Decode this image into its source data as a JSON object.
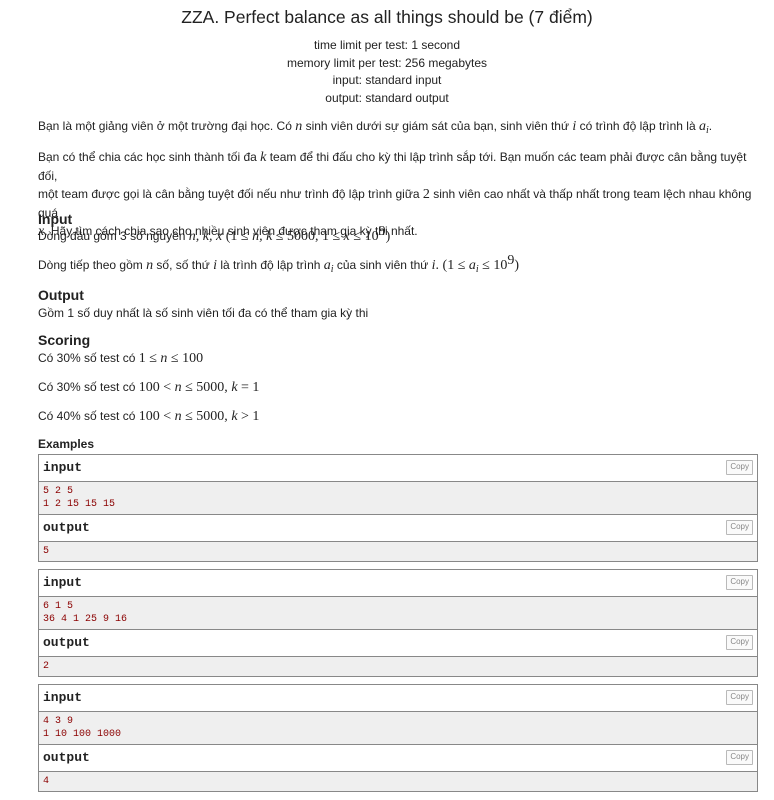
{
  "header": {
    "title": "ZZA. Perfect balance as all things should be (7 điểm)",
    "time_limit": "time limit per test: 1 second",
    "memory_limit": "memory limit per test: 256 megabytes",
    "input": "input: standard input",
    "output": "output: standard output"
  },
  "statement": {
    "p1_a": "Bạn là một giảng viên ở một trường đại học. Có ",
    "p1_n": "n",
    "p1_b": " sinh viên dưới sự giám sát của bạn, sinh viên thứ ",
    "p1_i": "i",
    "p1_c": " có trình độ lập trình là ",
    "p1_a_var": "a",
    "p1_a_sub": "i",
    "p1_end": ".",
    "p2_a": "Bạn có thể chia các học sinh thành tối đa ",
    "p2_k": "k",
    "p2_b": " team để thi đấu cho kỳ thi lập trình sắp tới. Bạn muốn các team phải được cân bằng tuyệt đối,",
    "p2_line2_a": "một team được gọi là cân bằng tuyệt đối nếu như trình độ lập trình giữa ",
    "p2_two": "2",
    "p2_line2_b": " sinh viên cao nhất và thấp nhất trong team lệch nhau không quá",
    "p2_x": "x",
    "p2_line3": ". Hãy tìm cách chia sao cho nhiều sinh viên được tham gia kỳ thi nhất."
  },
  "input_section": {
    "heading": "Input",
    "l1_a": "Dòng đầu gồm 3 số nguyên ",
    "l1_vars": "n, k, x",
    "l1_cond_a": " (1 ≤ ",
    "l1_cond_b": "n, k",
    "l1_cond_c": " ≤ 5000, 1 ≤ ",
    "l1_cond_d": "x",
    "l1_cond_e": " ≤ 10",
    "l1_cond_sup": "9",
    "l1_cond_f": ")",
    "l2_a": "Dòng tiếp theo gồm ",
    "l2_n": "n",
    "l2_b": " số, số thứ ",
    "l2_i": "i",
    "l2_c": " là trình độ lập trình ",
    "l2_a_var": "a",
    "l2_a_sub": "i",
    "l2_d": " của sinh viên thứ ",
    "l2_i2": "i",
    "l2_e": ". (1 ≤ ",
    "l2_a_var2": "a",
    "l2_a_sub2": "i",
    "l2_f": " ≤ 10",
    "l2_sup": "9",
    "l2_g": ")"
  },
  "output_section": {
    "heading": "Output",
    "text": "Gồm 1 số duy nhất là số sinh viên tối đa có thể tham gia kỳ thi"
  },
  "scoring": {
    "heading": "Scoring",
    "s1_a": "Có 30% số test có ",
    "s1_b": "1 ≤ ",
    "s1_n": "n",
    "s1_c": " ≤ 100",
    "s2_a": "Có 30% số test có ",
    "s2_b": "100 < ",
    "s2_n": "n",
    "s2_c": " ≤ 5000, ",
    "s2_k": "k",
    "s2_d": " = 1",
    "s3_a": "Có 40% số test có ",
    "s3_b": "100 < ",
    "s3_n": "n",
    "s3_c": " ≤ 5000, ",
    "s3_k": "k",
    "s3_d": " > 1"
  },
  "examples": {
    "heading": "Examples",
    "input_label": "input",
    "output_label": "output",
    "copy_label": "Copy",
    "samples": [
      {
        "input": "5 2 5\n1 2 15 15 15",
        "output": "5"
      },
      {
        "input": "6 1 5\n36 4 1 25 9 16",
        "output": "2"
      },
      {
        "input": "4 3 9\n1 10 100 1000",
        "output": "4"
      }
    ]
  }
}
